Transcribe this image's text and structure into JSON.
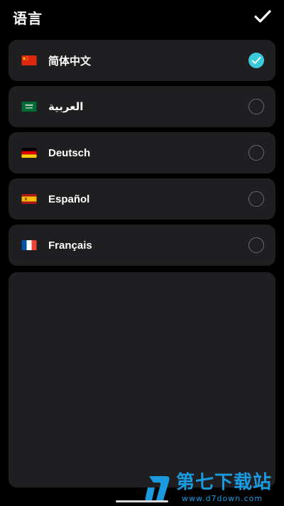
{
  "header": {
    "title": "语言",
    "confirm_icon": "checkmark-icon"
  },
  "languages": [
    {
      "label": "简体中文",
      "flag": "china-flag-icon",
      "selected": true
    },
    {
      "label": "العربية",
      "flag": "saudi-arabia-flag-icon",
      "selected": false
    },
    {
      "label": "Deutsch",
      "flag": "germany-flag-icon",
      "selected": false
    },
    {
      "label": "Español",
      "flag": "spain-flag-icon",
      "selected": false
    },
    {
      "label": "Français",
      "flag": "france-flag-icon",
      "selected": false
    }
  ],
  "colors": {
    "background": "#000000",
    "card": "#1f1f21",
    "accent": "#3cc9dc",
    "watermark": "#1a9be0"
  },
  "watermark": {
    "text": "第七下载站",
    "url": "www.d7down.com"
  }
}
